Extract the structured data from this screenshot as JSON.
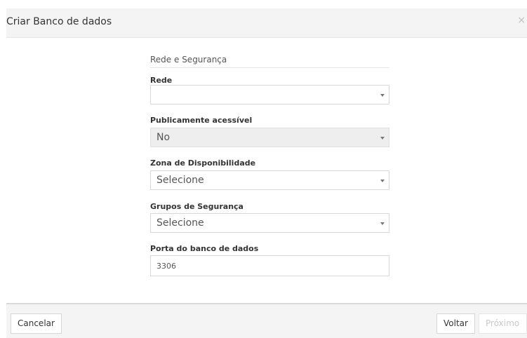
{
  "modal": {
    "title": "Criar Banco de dados",
    "close_label": "×"
  },
  "section": {
    "title": "Rede e Segurança"
  },
  "fields": {
    "network": {
      "label": "Rede",
      "value": ""
    },
    "public": {
      "label": "Publicamente acessível",
      "value": "No"
    },
    "zone": {
      "label": "Zona de Disponibilidade",
      "value": "Selecione"
    },
    "security_groups": {
      "label": "Grupos de Segurança",
      "value": "Selecione"
    },
    "port": {
      "label": "Porta do banco de dados",
      "value": "3306"
    }
  },
  "footer": {
    "cancel_label": "Cancelar",
    "back_label": "Voltar",
    "next_label": "Próximo"
  }
}
